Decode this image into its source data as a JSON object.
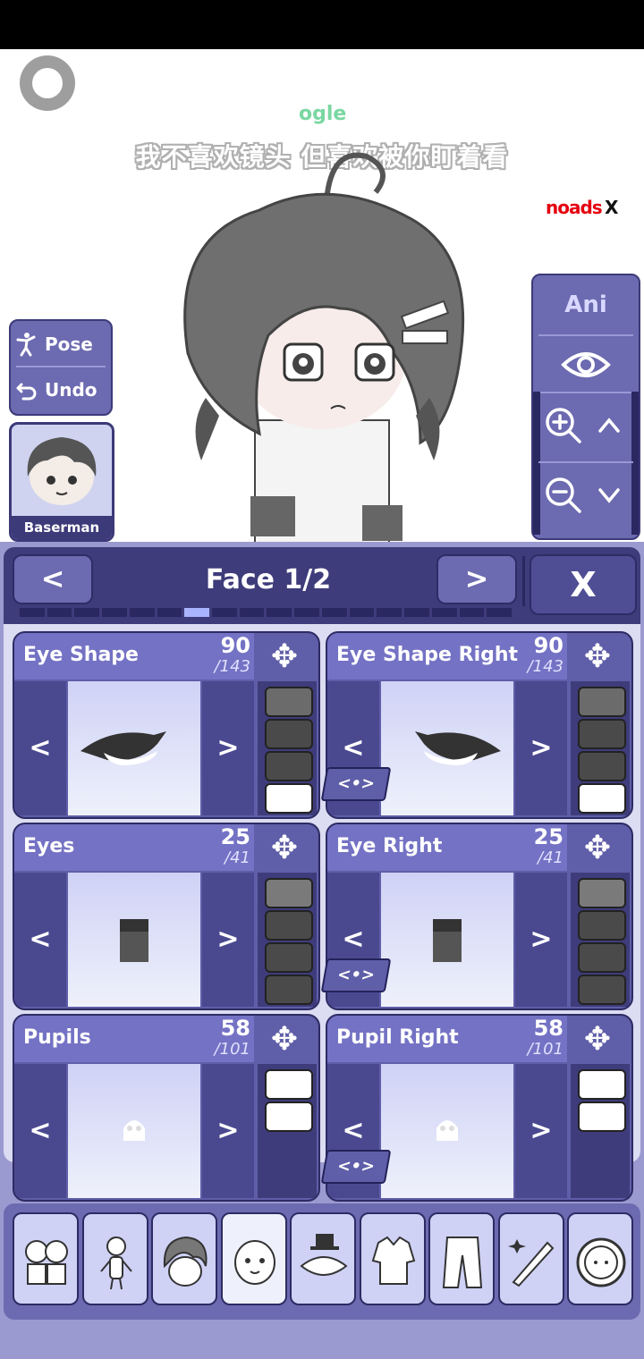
{
  "overlay": {
    "app_watermark": "ogle",
    "lyric": "我不喜欢镜头 但喜欢被你盯着看",
    "noads_label": "noads",
    "noads_close": "X"
  },
  "left_panel": {
    "pose_label": "Pose",
    "undo_label": "Undo",
    "save_slot_name": "Baserman"
  },
  "right_panel": {
    "ani_label": "Ani"
  },
  "editor": {
    "title": "Face 1/2",
    "prev": "<",
    "next": ">",
    "close": "X",
    "progress_segments": 18,
    "progress_active_index": 6,
    "cards": [
      {
        "title": "Eye Shape",
        "value": "90",
        "total": "/143",
        "left": "<",
        "right": ">",
        "swatches": [
          "#6b6b6b",
          "#4a4a4a",
          "#4a4a4a",
          "#ffffff"
        ]
      },
      {
        "title": "Eye Shape Right",
        "value": "90",
        "total": "/143",
        "left": "<",
        "right": ">",
        "link": "<•>",
        "swatches": [
          "#6b6b6b",
          "#4a4a4a",
          "#4a4a4a",
          "#ffffff"
        ]
      },
      {
        "title": "Eyes",
        "value": "25",
        "total": "/41",
        "left": "<",
        "right": ">",
        "swatches": [
          "#7a7a7a",
          "#4a4a4a",
          "#4a4a4a",
          "#4a4a4a"
        ]
      },
      {
        "title": "Eye Right",
        "value": "25",
        "total": "/41",
        "left": "<",
        "right": ">",
        "link": "<•>",
        "swatches": [
          "#7a7a7a",
          "#4a4a4a",
          "#4a4a4a",
          "#4a4a4a"
        ]
      },
      {
        "title": "Pupils",
        "value": "58",
        "total": "/101",
        "left": "<",
        "right": ">",
        "swatches": [
          "#ffffff",
          "#ffffff"
        ]
      },
      {
        "title": "Pupil Right",
        "value": "58",
        "total": "/101",
        "left": "<",
        "right": ">",
        "link": "<•>",
        "swatches": [
          "#ffffff",
          "#ffffff"
        ]
      }
    ]
  },
  "bottom_tabs": [
    {
      "name": "presets-tab"
    },
    {
      "name": "body-tab"
    },
    {
      "name": "hair-tab"
    },
    {
      "name": "face-tab",
      "active": true
    },
    {
      "name": "accessories-tab"
    },
    {
      "name": "top-clothing-tab"
    },
    {
      "name": "bottom-clothing-tab"
    },
    {
      "name": "props-tab"
    },
    {
      "name": "profile-tab"
    }
  ],
  "colors": {
    "panel": "#6c6ab0",
    "panel_dark": "#3e3c7a",
    "accent_text": "#ffffff",
    "noads_red": "#e50010"
  }
}
